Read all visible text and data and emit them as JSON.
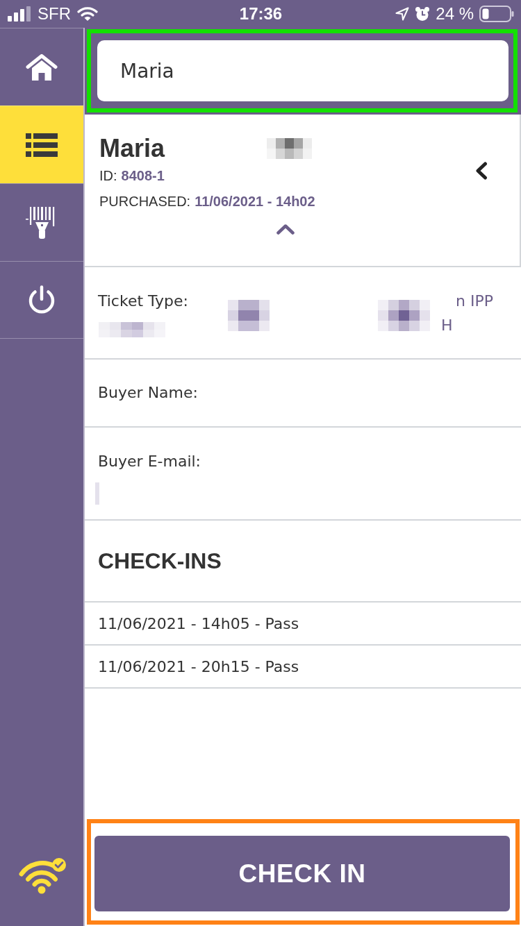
{
  "status_bar": {
    "carrier": "SFR",
    "time": "17:36",
    "battery": "24 %"
  },
  "sidebar": {
    "items": [
      {
        "kind": "home",
        "selected": false
      },
      {
        "kind": "list",
        "selected": true
      },
      {
        "kind": "scanner",
        "selected": false
      },
      {
        "kind": "power",
        "selected": false
      }
    ]
  },
  "search": {
    "value": "Maria",
    "highlighted": true
  },
  "record": {
    "name": "Maria",
    "redacted": true,
    "id_label": "ID:",
    "id": "8408-1",
    "purchased_label": "PURCHASED:",
    "purchased": "11/06/2021 - 14h02",
    "expanded": true
  },
  "details": [
    {
      "kind": "wrapped",
      "label": "Ticket Type:",
      "value_lines": [
        "n IPP",
        "H"
      ],
      "redacted": true
    },
    {
      "kind": "inline",
      "label": "Buyer Name:"
    },
    {
      "kind": "stacked",
      "label": "Buyer E-mail:",
      "redacted": true
    }
  ],
  "check_ins": {
    "title": "CHECK-INS",
    "entries": [
      "11/06/2021 - 14h05 - Pass",
      "11/06/2021 - 20h15 - Pass"
    ]
  },
  "check_in_button": {
    "label": "CHECK IN",
    "highlighted": true
  }
}
